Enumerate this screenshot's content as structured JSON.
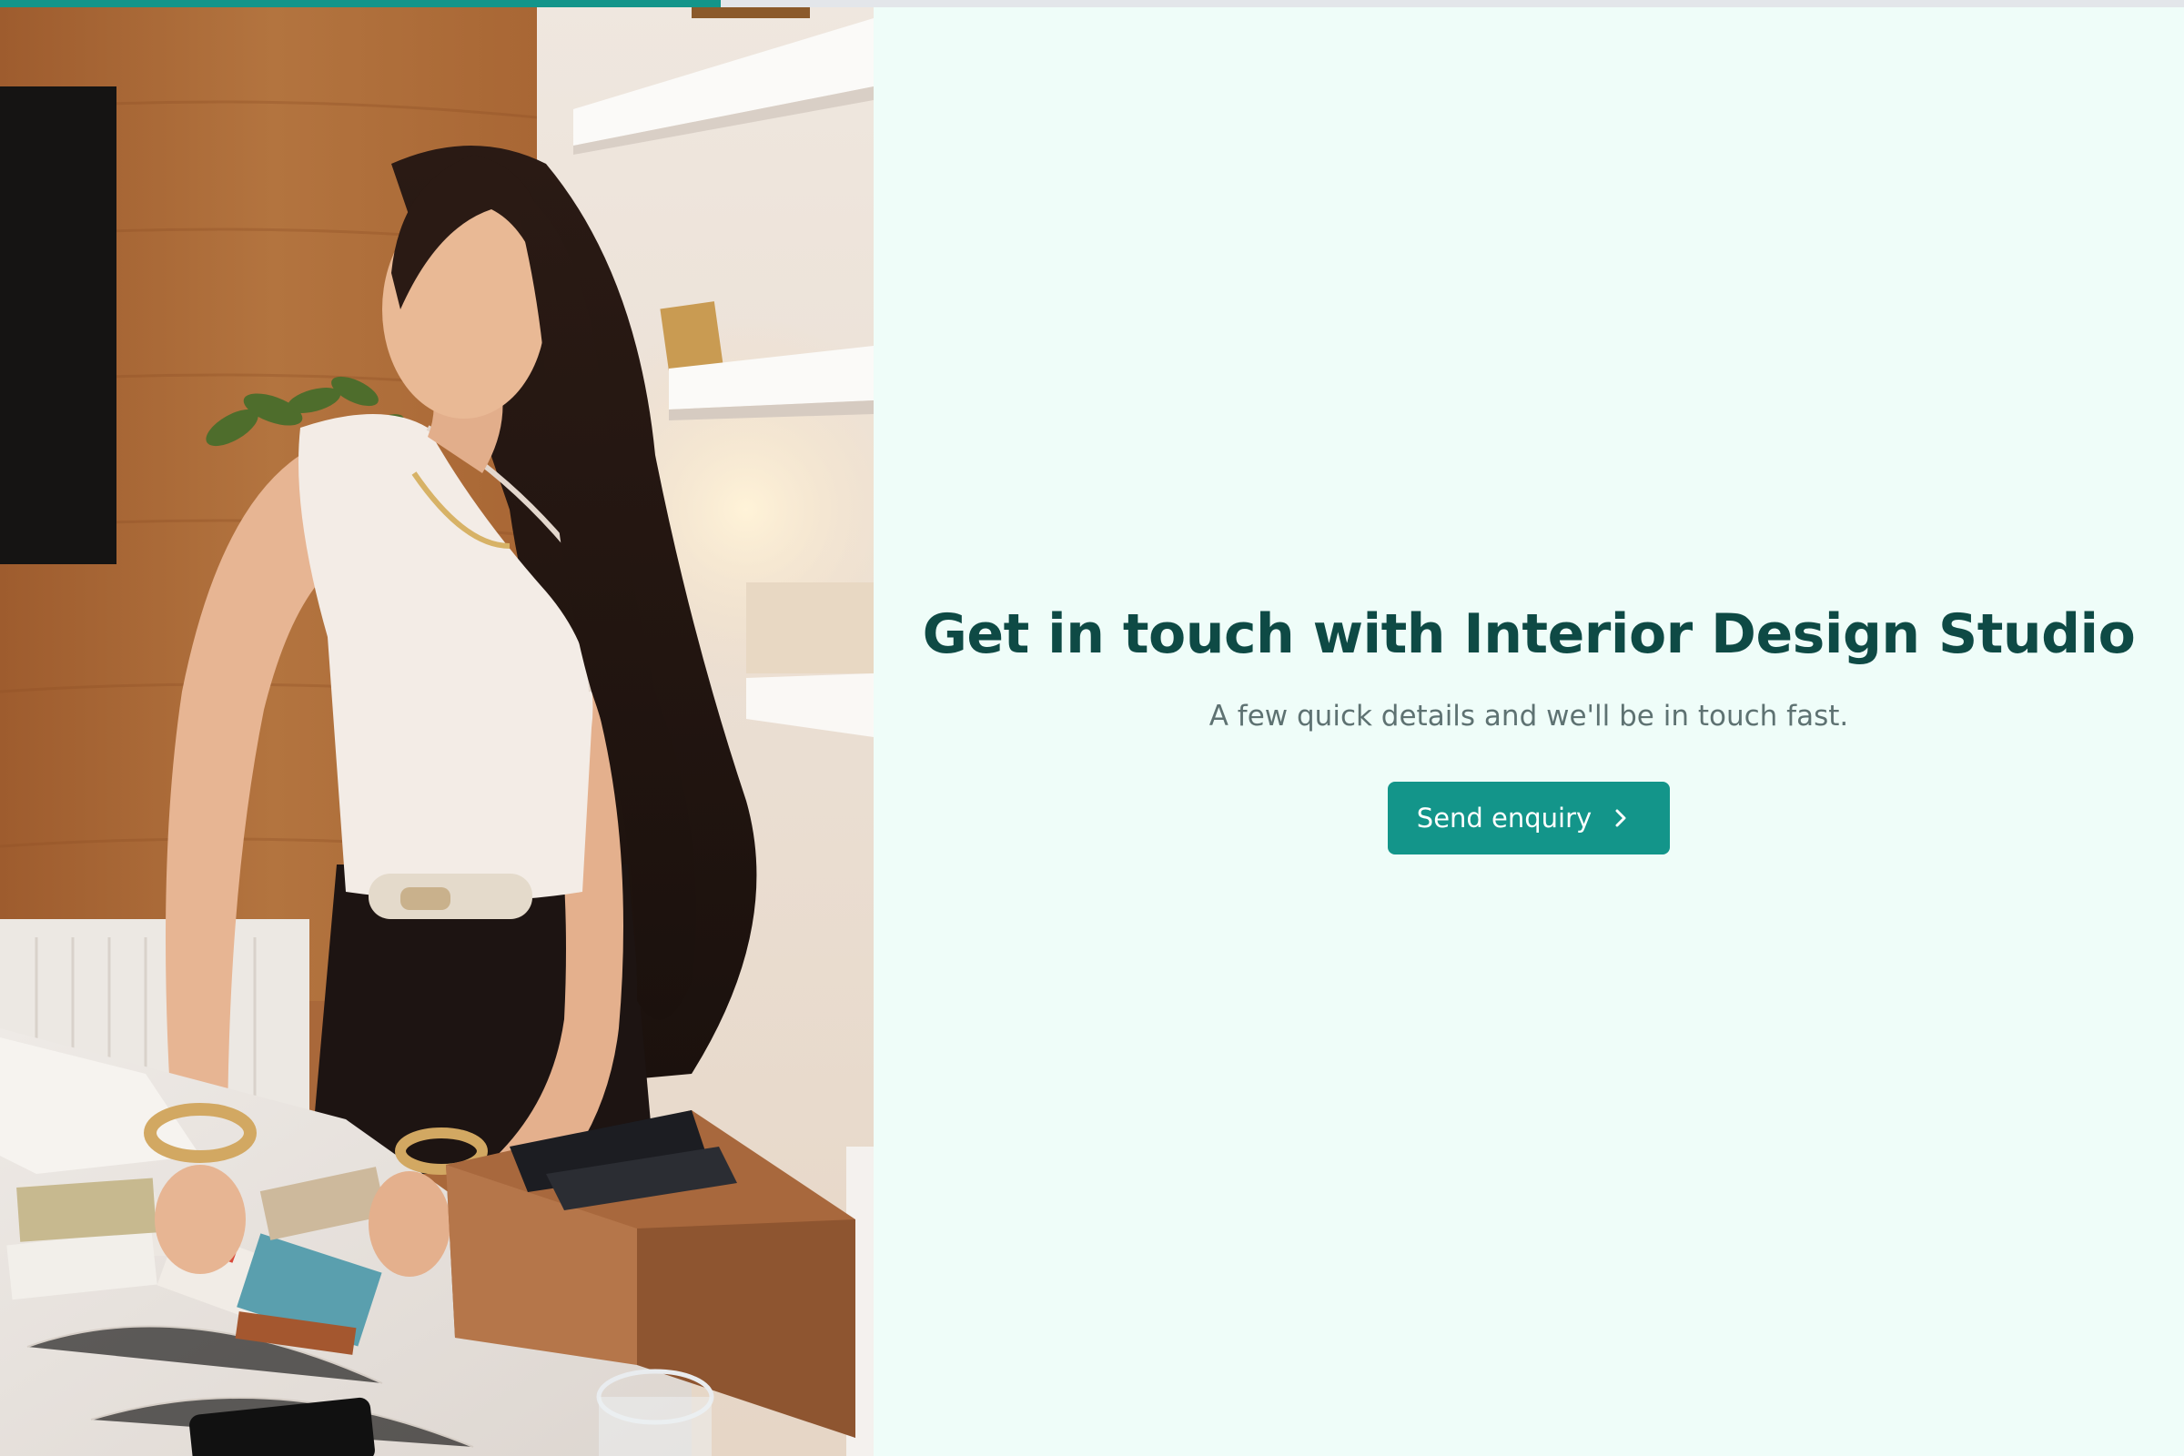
{
  "progress": {
    "fraction": 0.33
  },
  "hero_image": {
    "alt": "Interior designer selecting fabric swatches at a marble table"
  },
  "content": {
    "title": "Get in touch with Interior Design Studio",
    "subtitle": "A few quick details and we'll be in touch fast.",
    "cta": {
      "label": "Send enquiry",
      "icon": "chevron-right-icon"
    }
  },
  "colors": {
    "accent": "#13958a",
    "title": "#0e4a45",
    "subtitle": "#5e7272",
    "background": "#effdf9",
    "progress_track": "#e3e6ea"
  }
}
